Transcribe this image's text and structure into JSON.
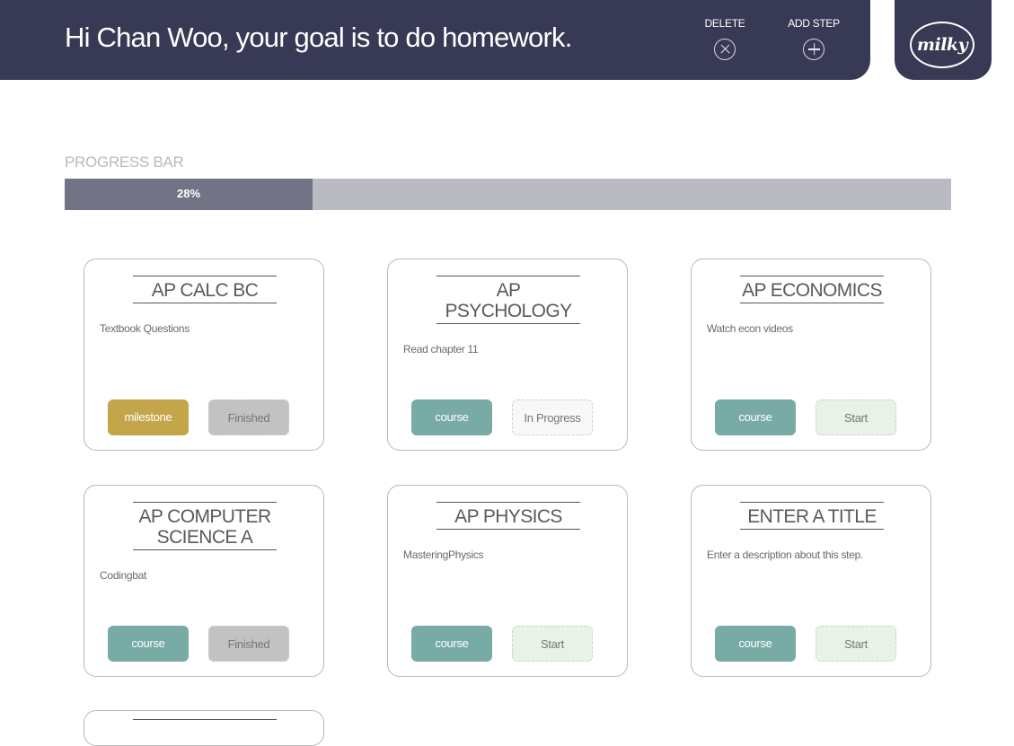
{
  "header": {
    "greeting": "Hi Chan Woo, your goal is to do homework.",
    "actions": {
      "delete_label": "DELETE",
      "add_label": "ADD STEP"
    },
    "logo_text": "milky"
  },
  "progress": {
    "label": "PROGRESS BAR",
    "percent_text": "28%",
    "value": 0.28
  },
  "colors": {
    "header_bg": "#383a55",
    "course": "#78aba5",
    "milestone": "#c3a64a",
    "finished": "#c2c2c2",
    "start": "#e9f2e6",
    "progress_fill": "#727486",
    "progress_track": "#b9bac2"
  },
  "cards": [
    {
      "title_lines": [
        "AP CALC BC"
      ],
      "description": "Textbook Questions",
      "type": "milestone",
      "status": "Finished"
    },
    {
      "title_lines": [
        "AP",
        "PSYCHOLOGY"
      ],
      "description": "Read chapter 11",
      "type": "course",
      "status": "In Progress"
    },
    {
      "title_lines": [
        "AP ECONOMICS"
      ],
      "description": "Watch econ videos",
      "type": "course",
      "status": "Start"
    },
    {
      "title_lines": [
        "AP COMPUTER",
        "SCIENCE A"
      ],
      "description": "Codingbat",
      "type": "course",
      "status": "Finished"
    },
    {
      "title_lines": [
        "AP PHYSICS"
      ],
      "description": "MasteringPhysics",
      "type": "course",
      "status": "Start"
    },
    {
      "title_lines": [
        "ENTER A TITLE"
      ],
      "description": "Enter a description about this step.",
      "type": "course",
      "status": "Start"
    }
  ],
  "icons": {
    "delete": "close-circle-icon",
    "add": "plus-circle-icon"
  }
}
